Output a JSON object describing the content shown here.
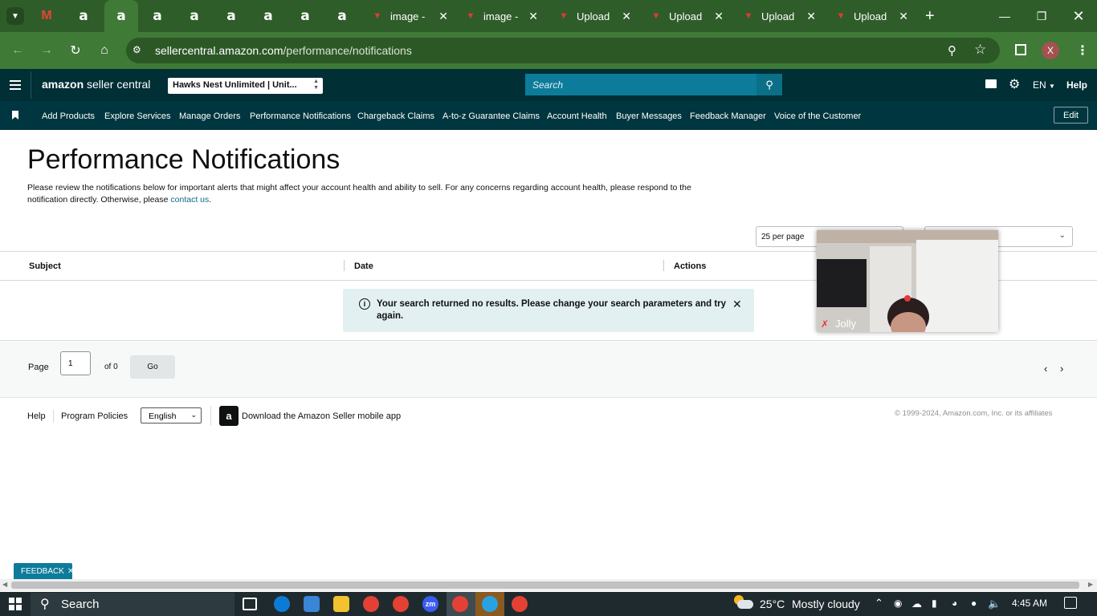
{
  "browser": {
    "tabs": [
      {
        "label": "",
        "icon": "gmail-icon",
        "active": false
      },
      {
        "label": "",
        "icon": "amazon-icon",
        "active": false
      },
      {
        "label": "",
        "icon": "amazon-icon",
        "active": true
      },
      {
        "label": "",
        "icon": "amazon-icon",
        "active": false
      },
      {
        "label": "",
        "icon": "amazon-icon",
        "active": false
      },
      {
        "label": "",
        "icon": "amazon-icon",
        "active": false
      },
      {
        "label": "",
        "icon": "amazon-icon",
        "active": false
      },
      {
        "label": "",
        "icon": "amazon-icon",
        "active": false
      },
      {
        "label": "",
        "icon": "amazon-icon",
        "active": false
      },
      {
        "label": "image -",
        "icon": "upload-app-icon",
        "active": false
      },
      {
        "label": "image -",
        "icon": "upload-app-icon",
        "active": false
      },
      {
        "label": "Upload",
        "icon": "upload-app-icon",
        "active": false
      },
      {
        "label": "Upload",
        "icon": "upload-app-icon",
        "active": false
      },
      {
        "label": "Upload",
        "icon": "upload-app-icon",
        "active": false
      },
      {
        "label": "Upload",
        "icon": "upload-app-icon",
        "active": false
      }
    ],
    "url_domain": "sellercentral.amazon.com",
    "url_path": "/performance/notifications",
    "profile_initial": "X"
  },
  "header": {
    "logo_text": "amazon seller central",
    "store_selector": "Hawks Nest Unlimited | Unit...",
    "search_placeholder": "Search",
    "language": "EN",
    "help": "Help"
  },
  "nav": {
    "items": [
      "Add Products",
      "Explore Services",
      "Manage Orders",
      "Performance Notifications",
      "Chargeback Claims",
      "A-to-z Guarantee Claims",
      "Account Health",
      "Buyer Messages",
      "Feedback Manager",
      "Voice of the Customer"
    ],
    "edit": "Edit"
  },
  "main": {
    "title": "Performance Notifications",
    "description": "Please review the notifications below for important alerts that might affect your account health and ability to sell. For any concerns regarding account health, please respond to the notification directly. Otherwise, please",
    "contact_link": "contact us",
    "per_page": "25 per page",
    "columns": [
      "Subject",
      "Date",
      "Actions"
    ],
    "alert": "Your search returned no results. Please change your search parameters and try again.",
    "pager": {
      "page_label": "Page",
      "page_value": "1",
      "of_label": "of 0",
      "go": "Go"
    }
  },
  "footer": {
    "help": "Help",
    "policies": "Program Policies",
    "language": "English",
    "app_download": "Download the Amazon Seller mobile app",
    "copyright": "© 1999-2024, Amazon.com, Inc. or its affiliates"
  },
  "video": {
    "name": "Jolly"
  },
  "feedback": "FEEDBACK",
  "taskbar": {
    "search": "Search",
    "temperature": "25°C",
    "weather": "Mostly cloudy",
    "time": "4:45 AM"
  },
  "colors": {
    "header": "#002f36",
    "nav": "#00363f",
    "accent": "#0d7c9a",
    "browser": "#3f7a37"
  }
}
